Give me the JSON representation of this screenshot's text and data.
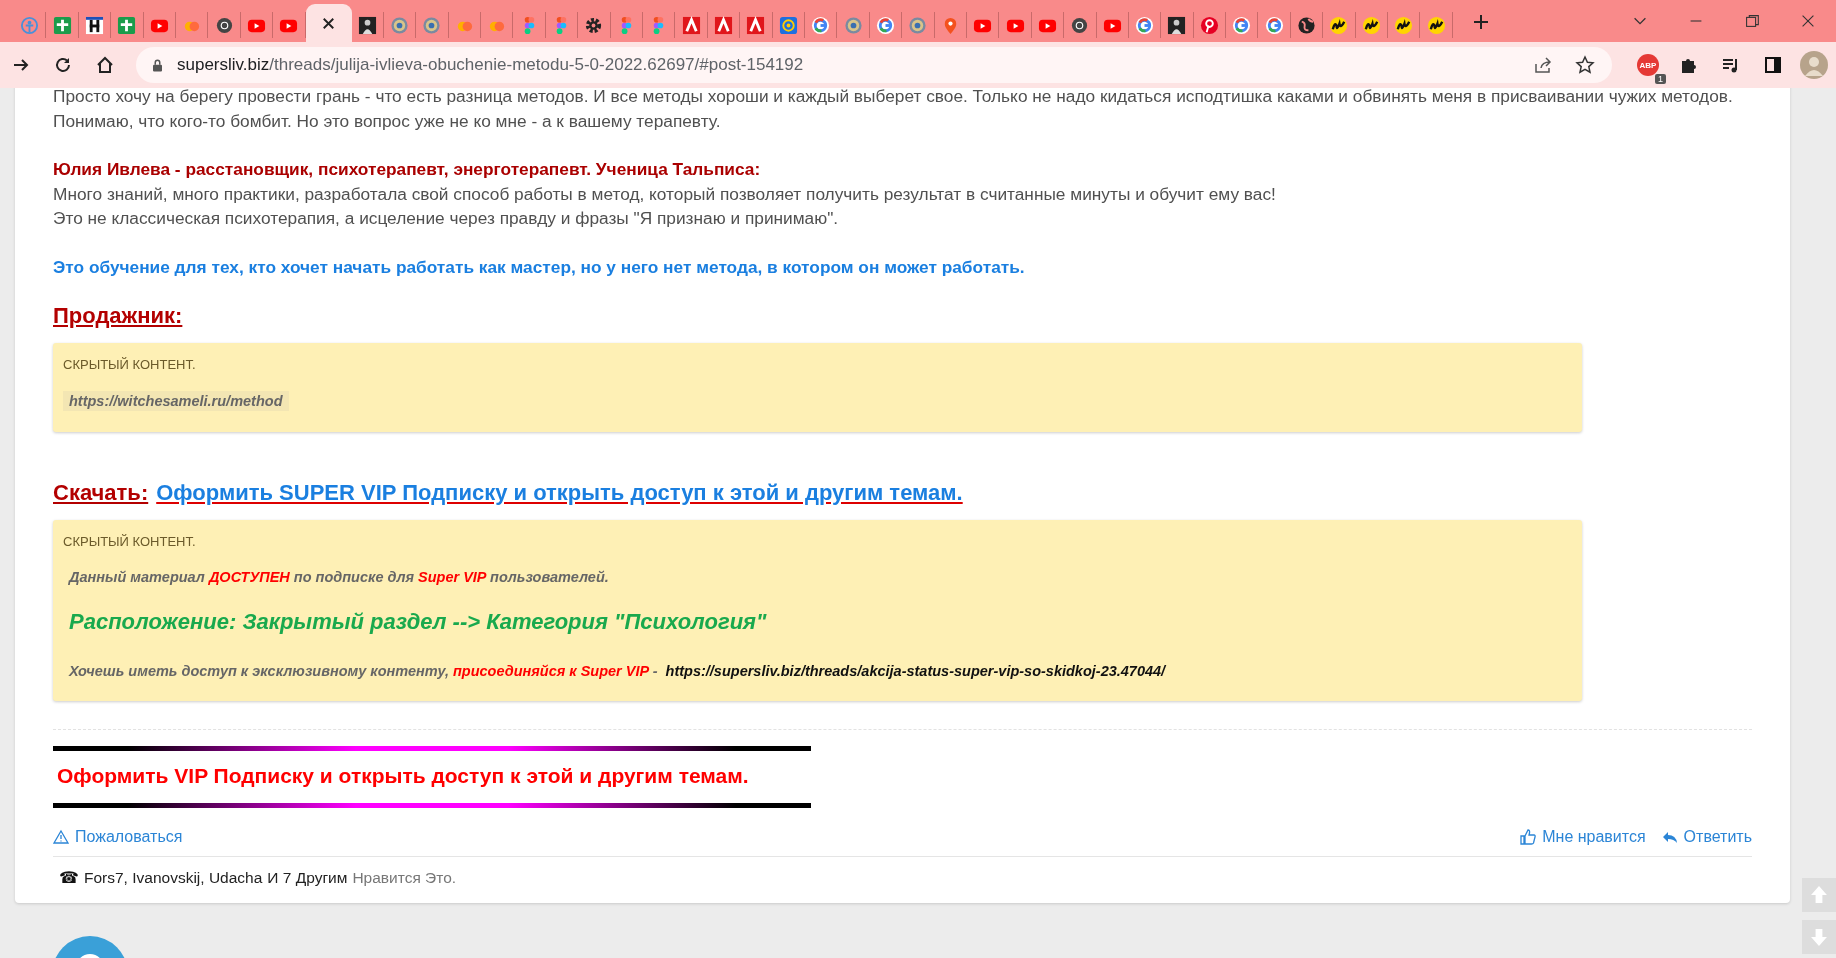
{
  "tabs": [
    {
      "kind": "person",
      "selected": false
    },
    {
      "kind": "plus",
      "selected": false
    },
    {
      "kind": "h",
      "selected": false
    },
    {
      "kind": "plus",
      "selected": false
    },
    {
      "kind": "play",
      "selected": false
    },
    {
      "kind": "cloud",
      "selected": false
    },
    {
      "kind": "chrome",
      "selected": false
    },
    {
      "kind": "play",
      "selected": false
    },
    {
      "kind": "play",
      "selected": false
    },
    {
      "selected": true
    },
    {
      "kind": "portrait",
      "selected": false
    },
    {
      "kind": "seal",
      "selected": false
    },
    {
      "kind": "seal",
      "selected": false
    },
    {
      "kind": "cloud",
      "selected": false
    },
    {
      "kind": "cloud",
      "selected": false
    },
    {
      "kind": "dots",
      "selected": false
    },
    {
      "kind": "dots",
      "selected": false
    },
    {
      "kind": "gear",
      "selected": false
    },
    {
      "kind": "dots",
      "selected": false
    },
    {
      "kind": "dots",
      "selected": false
    },
    {
      "kind": "a",
      "selected": false
    },
    {
      "kind": "a",
      "selected": false
    },
    {
      "kind": "a",
      "selected": false
    },
    {
      "kind": "at",
      "selected": false
    },
    {
      "kind": "ring",
      "selected": false
    },
    {
      "kind": "seal",
      "selected": false
    },
    {
      "kind": "ring",
      "selected": false
    },
    {
      "kind": "seal",
      "selected": false
    },
    {
      "kind": "pin",
      "selected": false
    },
    {
      "kind": "play",
      "selected": false
    },
    {
      "kind": "play",
      "selected": false
    },
    {
      "kind": "play",
      "selected": false
    },
    {
      "kind": "chrome",
      "selected": false
    },
    {
      "kind": "play",
      "selected": false
    },
    {
      "kind": "ring",
      "selected": false
    },
    {
      "kind": "portrait",
      "selected": false
    },
    {
      "kind": "pinterest",
      "selected": false
    },
    {
      "kind": "ring",
      "selected": false
    },
    {
      "kind": "ring",
      "selected": false
    },
    {
      "kind": "globe",
      "selected": false
    },
    {
      "kind": "m",
      "selected": false
    },
    {
      "kind": "m",
      "selected": false
    },
    {
      "kind": "m",
      "selected": false
    },
    {
      "kind": "m",
      "selected": false
    }
  ],
  "address": {
    "host": "supersliv.biz",
    "path": "/threads/julija-ivlieva-obuchenie-metodu-5-0-2022.62697/#post-154192"
  },
  "extensions": {
    "abp_label": "ABP",
    "abp_badge": "1"
  },
  "post": {
    "intro": "Просто хочу на берегу провести грань - что есть разница методов. И все методы хороши и каждый выберет свое. Только не надо кидаться исподтишка каками и обвинять меня в присваивании чужих методов. Понимаю, что кого-то бомбит. Но это вопрос уже не ко мне - а к вашему терапевту.",
    "author_heading": "Юлия Ивлева - расстановщик, психотерапевт, энерготерапевт. Ученица Тальписа:",
    "description": [
      "Много знаний, много практики, разработала свой способ работы в метод, который позволяет получить результат в считанные минуты и обучит ему вас!",
      "Это не классическая психотерапия, а исцеление через правду и фразы \"Я признаю и принимаю\"."
    ],
    "audience": "Это обучение для тех, кто хочет начать работать как мастер, но у него нет метода, в котором он может работать.",
    "seller_heading": "Продажник:",
    "seller_box": {
      "label": "СКРЫТЫЙ КОНТЕНТ.",
      "link": "https://witchesameli.ru/method"
    },
    "download": {
      "label": "Скачать:",
      "link": "Оформить SUPER VIP Подписку и открыть доступ к этой и другим темам."
    },
    "vip_box": {
      "label": "СКРЫТЫЙ КОНТЕНТ.",
      "notice": [
        {
          "text": "Данный материал ",
          "accent": false
        },
        {
          "text": "ДОСТУПЕН",
          "accent": true
        },
        {
          "text": " по подписке для ",
          "accent": false
        },
        {
          "text": "Super VIP",
          "accent": true
        },
        {
          "text": " пользователей.",
          "accent": false
        }
      ],
      "location": "Расположение: Закрытый раздел --> Категория \"Психология\"",
      "join": [
        {
          "text": "Хочешь иметь доступ к эксклюзивному контенту, ",
          "accent": false
        },
        {
          "text": "присоединяйся к Super VIP",
          "accent": true
        },
        {
          "text": " - ",
          "accent": false
        }
      ],
      "join_link": "https://supersliv.biz/threads/akcija-status-super-vip-so-skidkoj-23.47044/"
    }
  },
  "vip_banner": "Оформить VIP Подписку и открыть доступ к этой и другим темам.",
  "actions": {
    "report": "Пожаловаться",
    "like": "Мне нравится",
    "reply": "Ответить"
  },
  "likes": {
    "icon": "☎",
    "names": "Fors7, Ivanovskij, Udacha",
    "others": "И 7 Другим",
    "suffix": "Нравится Это."
  }
}
